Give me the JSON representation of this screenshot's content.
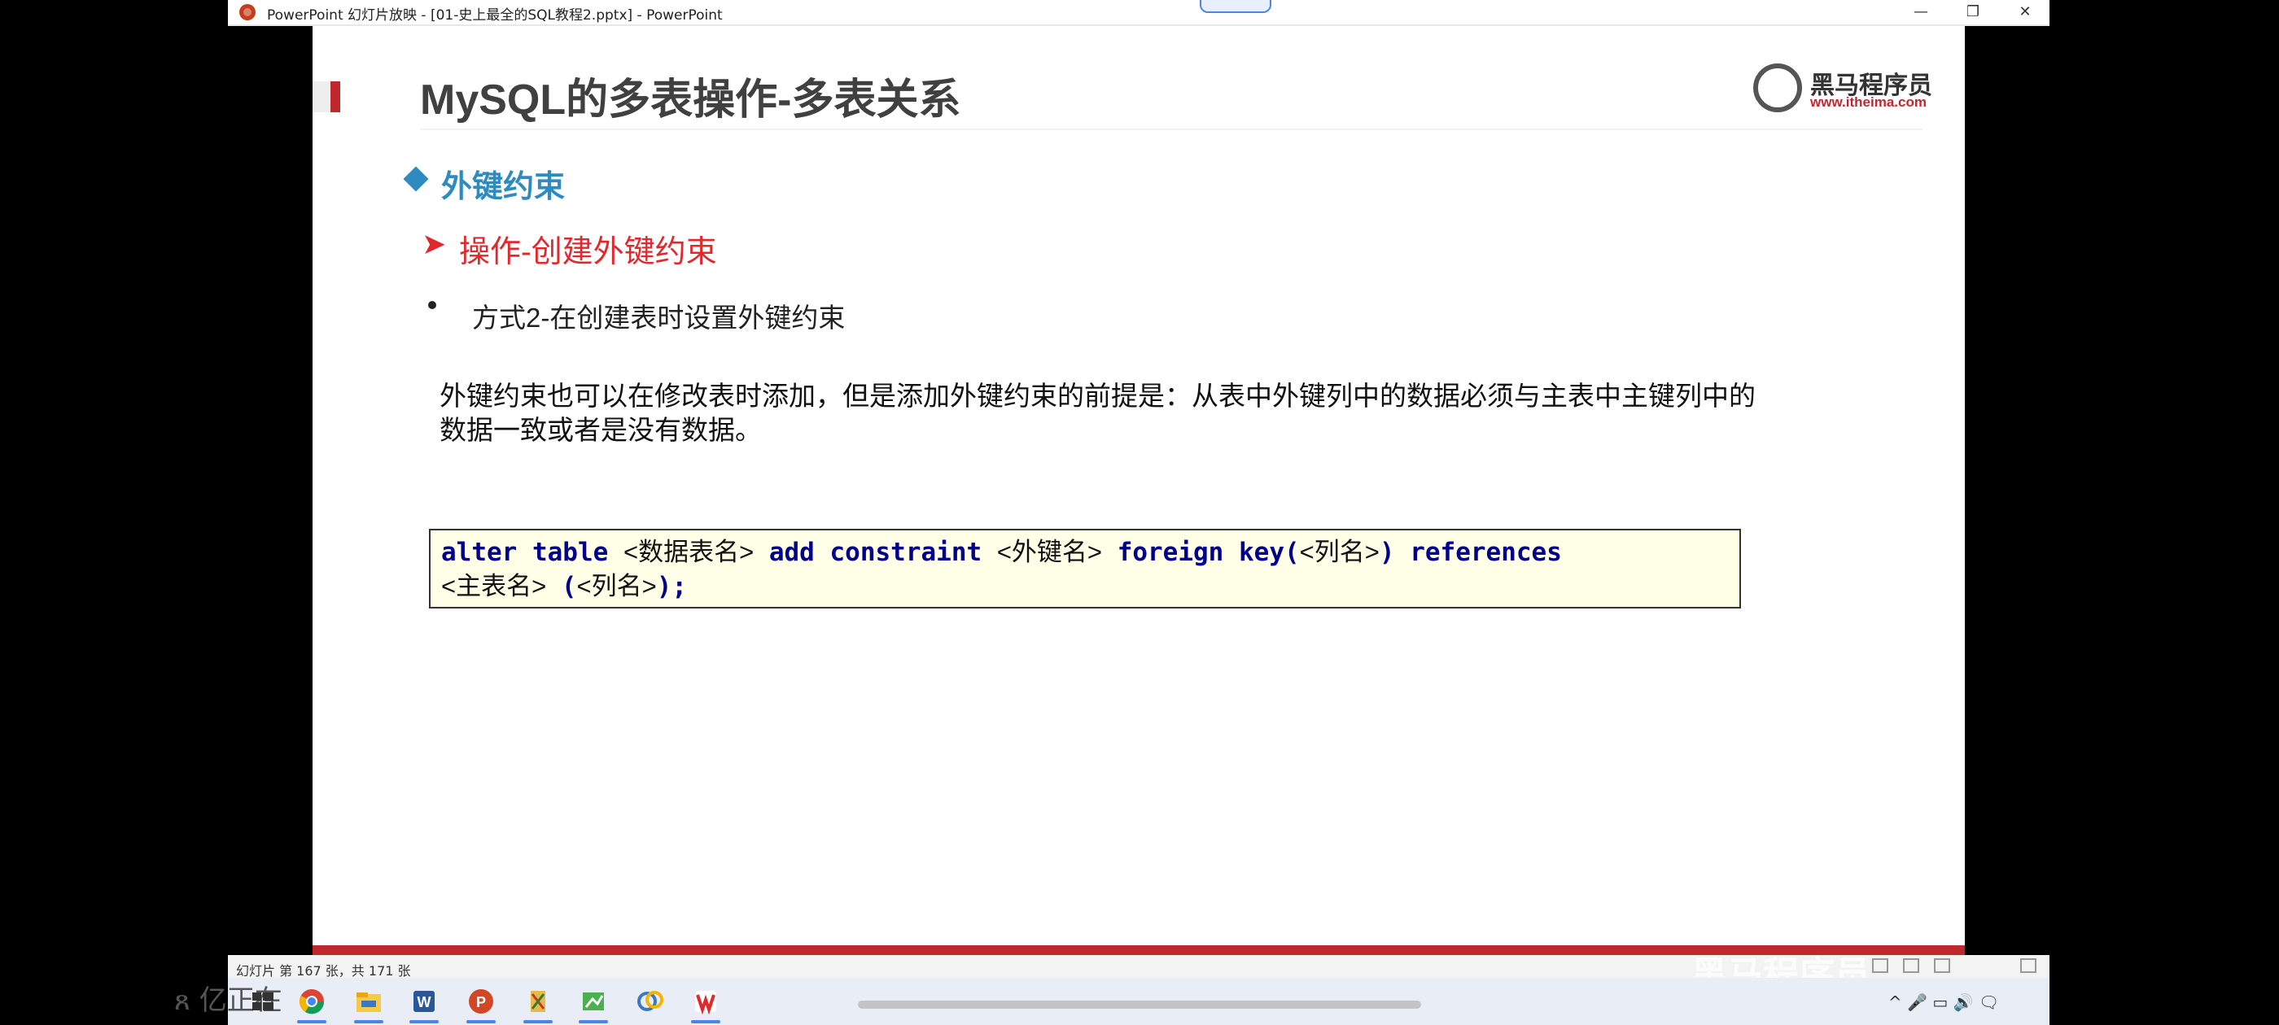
{
  "window": {
    "title": "PowerPoint 幻灯片放映 - [01-史上最全的SQL教程2.pptx] - PowerPoint",
    "minimize": "—",
    "restore": "❐",
    "close": "✕"
  },
  "slide": {
    "title": "MySQL的多表操作-多表关系",
    "logo_text": "黑马程序员",
    "logo_url": "www.itheima.com",
    "heading1": "外键约束",
    "heading2_arrow": "➤",
    "heading2": "操作-创建外键约束",
    "bullet_item": "方式2-在创建表时设置外键约束",
    "paragraph": "外键约束也可以在修改表时添加，但是添加外键约束的前提是：从表中外键列中的数据必须与主表中主键列中的数据一致或者是没有数据。",
    "code": {
      "kw1": "alter table ",
      "p1": "<数据表名>",
      "kw2": " add constraint ",
      "p2": "<外键名>",
      "kw3": " foreign key(",
      "p3": "<列名>",
      "kw4": ") references",
      "p4": "<主表名>",
      "kw5": " (",
      "p5": "<列名>",
      "kw6": ");"
    }
  },
  "status_bar": {
    "slide_info": "幻灯片 第 167 张，共 171 张"
  },
  "overlay": {
    "watermark": "黑马程序员",
    "ghost_text": "ጸ 亿正在"
  },
  "taskbar": {
    "apps": [
      "windows-start",
      "chrome",
      "file-explorer",
      "word",
      "powerpoint",
      "app-5",
      "app-6",
      "app-7",
      "wps"
    ],
    "tray_text": "^  🎤  ▭  🔊  🗨"
  },
  "colors": {
    "accent_red": "#c0282d",
    "heading_blue": "#2e8bc0",
    "code_blue": "#00008b",
    "code_bg": "#ffffe8"
  }
}
